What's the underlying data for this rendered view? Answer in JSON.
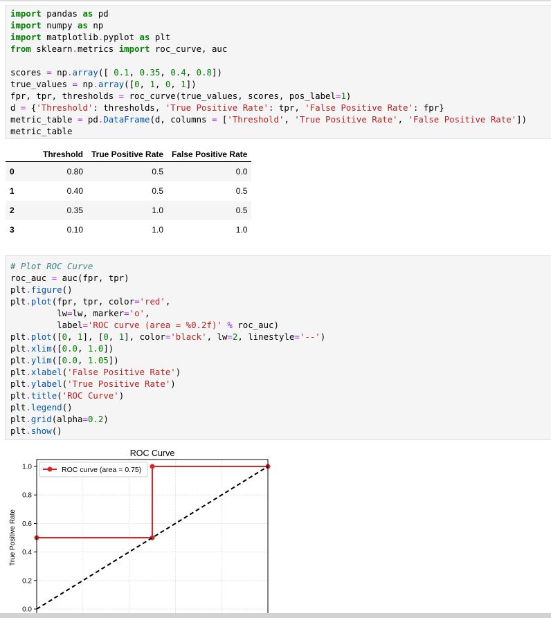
{
  "cell1": {
    "lines": [
      [
        {
          "t": "import",
          "c": "kw"
        },
        {
          "t": " pandas "
        },
        {
          "t": "as",
          "c": "kw"
        },
        {
          "t": " pd"
        }
      ],
      [
        {
          "t": "import",
          "c": "kw"
        },
        {
          "t": " numpy "
        },
        {
          "t": "as",
          "c": "kw"
        },
        {
          "t": " np"
        }
      ],
      [
        {
          "t": "import",
          "c": "kw"
        },
        {
          "t": " matplotlib"
        },
        {
          "t": ".",
          "c": "op"
        },
        {
          "t": "pyplot "
        },
        {
          "t": "as",
          "c": "kw"
        },
        {
          "t": " plt"
        }
      ],
      [
        {
          "t": "from",
          "c": "kw"
        },
        {
          "t": " sklearn"
        },
        {
          "t": ".",
          "c": "op"
        },
        {
          "t": "metrics "
        },
        {
          "t": "import",
          "c": "kw"
        },
        {
          "t": " roc_curve, auc"
        }
      ],
      [],
      [
        {
          "t": "scores "
        },
        {
          "t": "=",
          "c": "op"
        },
        {
          "t": " np"
        },
        {
          "t": ".",
          "c": "op"
        },
        {
          "t": "array",
          "c": "attr"
        },
        {
          "t": "([ "
        },
        {
          "t": "0.1",
          "c": "num"
        },
        {
          "t": ", "
        },
        {
          "t": "0.35",
          "c": "num"
        },
        {
          "t": ", "
        },
        {
          "t": "0.4",
          "c": "num"
        },
        {
          "t": ", "
        },
        {
          "t": "0.8",
          "c": "num"
        },
        {
          "t": "])"
        }
      ],
      [
        {
          "t": "true_values "
        },
        {
          "t": "=",
          "c": "op"
        },
        {
          "t": " np"
        },
        {
          "t": ".",
          "c": "op"
        },
        {
          "t": "array",
          "c": "attr"
        },
        {
          "t": "(["
        },
        {
          "t": "0",
          "c": "num"
        },
        {
          "t": ", "
        },
        {
          "t": "1",
          "c": "num"
        },
        {
          "t": ", "
        },
        {
          "t": "0",
          "c": "num"
        },
        {
          "t": ", "
        },
        {
          "t": "1",
          "c": "num"
        },
        {
          "t": "])"
        }
      ],
      [
        {
          "t": "fpr, tpr, thresholds "
        },
        {
          "t": "=",
          "c": "op"
        },
        {
          "t": " roc_curve(true_values, scores, pos_label"
        },
        {
          "t": "=",
          "c": "op"
        },
        {
          "t": "1",
          "c": "num"
        },
        {
          "t": ")"
        }
      ],
      [
        {
          "t": "d "
        },
        {
          "t": "=",
          "c": "op"
        },
        {
          "t": " {"
        },
        {
          "t": "'Threshold'",
          "c": "str"
        },
        {
          "t": ": thresholds, "
        },
        {
          "t": "'True Positive Rate'",
          "c": "str"
        },
        {
          "t": ": tpr, "
        },
        {
          "t": "'False Positive Rate'",
          "c": "str"
        },
        {
          "t": ": fpr}"
        }
      ],
      [
        {
          "t": "metric_table "
        },
        {
          "t": "=",
          "c": "op"
        },
        {
          "t": " pd"
        },
        {
          "t": ".",
          "c": "op"
        },
        {
          "t": "DataFrame",
          "c": "attr"
        },
        {
          "t": "(d, columns "
        },
        {
          "t": "=",
          "c": "op"
        },
        {
          "t": " ["
        },
        {
          "t": "'Threshold'",
          "c": "str"
        },
        {
          "t": ", "
        },
        {
          "t": "'True Positive Rate'",
          "c": "str"
        },
        {
          "t": ", "
        },
        {
          "t": "'False Positive Rate'",
          "c": "str"
        },
        {
          "t": "])"
        }
      ],
      [
        {
          "t": "metric_table"
        }
      ]
    ]
  },
  "table": {
    "columns": [
      "Threshold",
      "True Positive Rate",
      "False Positive Rate"
    ],
    "rows": [
      {
        "index": "0",
        "threshold": "0.80",
        "tpr": "0.5",
        "fpr": "0.0"
      },
      {
        "index": "1",
        "threshold": "0.40",
        "tpr": "0.5",
        "fpr": "0.5"
      },
      {
        "index": "2",
        "threshold": "0.35",
        "tpr": "1.0",
        "fpr": "0.5"
      },
      {
        "index": "3",
        "threshold": "0.10",
        "tpr": "1.0",
        "fpr": "1.0"
      }
    ]
  },
  "cell2": {
    "lines": [
      [
        {
          "t": "# Plot ROC Curve",
          "c": "cmt"
        }
      ],
      [
        {
          "t": "roc_auc "
        },
        {
          "t": "=",
          "c": "op"
        },
        {
          "t": " auc(fpr, tpr)"
        }
      ],
      [
        {
          "t": "plt"
        },
        {
          "t": ".",
          "c": "op"
        },
        {
          "t": "figure",
          "c": "attr"
        },
        {
          "t": "()"
        }
      ],
      [
        {
          "t": "plt"
        },
        {
          "t": ".",
          "c": "op"
        },
        {
          "t": "plot",
          "c": "attr"
        },
        {
          "t": "(fpr, tpr, color"
        },
        {
          "t": "=",
          "c": "op"
        },
        {
          "t": "'red'",
          "c": "str"
        },
        {
          "t": ","
        }
      ],
      [
        {
          "t": "         lw"
        },
        {
          "t": "=",
          "c": "op"
        },
        {
          "t": "lw, marker"
        },
        {
          "t": "=",
          "c": "op"
        },
        {
          "t": "'o'",
          "c": "str"
        },
        {
          "t": ","
        }
      ],
      [
        {
          "t": "         label"
        },
        {
          "t": "=",
          "c": "op"
        },
        {
          "t": "'ROC curve (area = %0.2f)'",
          "c": "str"
        },
        {
          "t": " "
        },
        {
          "t": "%",
          "c": "op"
        },
        {
          "t": " roc_auc)"
        }
      ],
      [
        {
          "t": "plt"
        },
        {
          "t": ".",
          "c": "op"
        },
        {
          "t": "plot",
          "c": "attr"
        },
        {
          "t": "(["
        },
        {
          "t": "0",
          "c": "num"
        },
        {
          "t": ", "
        },
        {
          "t": "1",
          "c": "num"
        },
        {
          "t": "], ["
        },
        {
          "t": "0",
          "c": "num"
        },
        {
          "t": ", "
        },
        {
          "t": "1",
          "c": "num"
        },
        {
          "t": "], color"
        },
        {
          "t": "=",
          "c": "op"
        },
        {
          "t": "'black'",
          "c": "str"
        },
        {
          "t": ", lw"
        },
        {
          "t": "=",
          "c": "op"
        },
        {
          "t": "2",
          "c": "num"
        },
        {
          "t": ", linestyle"
        },
        {
          "t": "=",
          "c": "op"
        },
        {
          "t": "'--'",
          "c": "str"
        },
        {
          "t": ")"
        }
      ],
      [
        {
          "t": "plt"
        },
        {
          "t": ".",
          "c": "op"
        },
        {
          "t": "xlim",
          "c": "attr"
        },
        {
          "t": "(["
        },
        {
          "t": "0.0",
          "c": "num"
        },
        {
          "t": ", "
        },
        {
          "t": "1.0",
          "c": "num"
        },
        {
          "t": "])"
        }
      ],
      [
        {
          "t": "plt"
        },
        {
          "t": ".",
          "c": "op"
        },
        {
          "t": "ylim",
          "c": "attr"
        },
        {
          "t": "(["
        },
        {
          "t": "0.0",
          "c": "num"
        },
        {
          "t": ", "
        },
        {
          "t": "1.05",
          "c": "num"
        },
        {
          "t": "])"
        }
      ],
      [
        {
          "t": "plt"
        },
        {
          "t": ".",
          "c": "op"
        },
        {
          "t": "xlabel",
          "c": "attr"
        },
        {
          "t": "("
        },
        {
          "t": "'False Positive Rate'",
          "c": "str"
        },
        {
          "t": ")"
        }
      ],
      [
        {
          "t": "plt"
        },
        {
          "t": ".",
          "c": "op"
        },
        {
          "t": "ylabel",
          "c": "attr"
        },
        {
          "t": "("
        },
        {
          "t": "'True Positive Rate'",
          "c": "str"
        },
        {
          "t": ")"
        }
      ],
      [
        {
          "t": "plt"
        },
        {
          "t": ".",
          "c": "op"
        },
        {
          "t": "title",
          "c": "attr"
        },
        {
          "t": "("
        },
        {
          "t": "'ROC Curve'",
          "c": "str"
        },
        {
          "t": ")"
        }
      ],
      [
        {
          "t": "plt"
        },
        {
          "t": ".",
          "c": "op"
        },
        {
          "t": "legend",
          "c": "attr"
        },
        {
          "t": "()"
        }
      ],
      [
        {
          "t": "plt"
        },
        {
          "t": ".",
          "c": "op"
        },
        {
          "t": "grid",
          "c": "attr"
        },
        {
          "t": "(alpha"
        },
        {
          "t": "=",
          "c": "op"
        },
        {
          "t": "0.2",
          "c": "num"
        },
        {
          "t": ")"
        }
      ],
      [
        {
          "t": "plt"
        },
        {
          "t": ".",
          "c": "op"
        },
        {
          "t": "show",
          "c": "attr"
        },
        {
          "t": "()"
        }
      ]
    ]
  },
  "chart_data": {
    "type": "line",
    "title": "ROC Curve",
    "ylabel": "True Positive Rate",
    "xlabel": "",
    "xlim": [
      0.0,
      1.0
    ],
    "ylim": [
      0.0,
      1.05
    ],
    "yticks": [
      "0.0",
      "0.2",
      "0.4",
      "0.6",
      "0.8",
      "1.0"
    ],
    "grid": true,
    "legend_position": "top-left",
    "series": [
      {
        "name": "ROC curve (area = 0.75)",
        "x": [
          0.0,
          0.5,
          0.5,
          1.0
        ],
        "y": [
          0.5,
          0.5,
          1.0,
          1.0
        ],
        "color": "#d62728",
        "marker": "o"
      },
      {
        "x": [
          0,
          1
        ],
        "y": [
          0,
          1
        ],
        "color": "#000000",
        "linestyle": "dashed"
      }
    ]
  }
}
